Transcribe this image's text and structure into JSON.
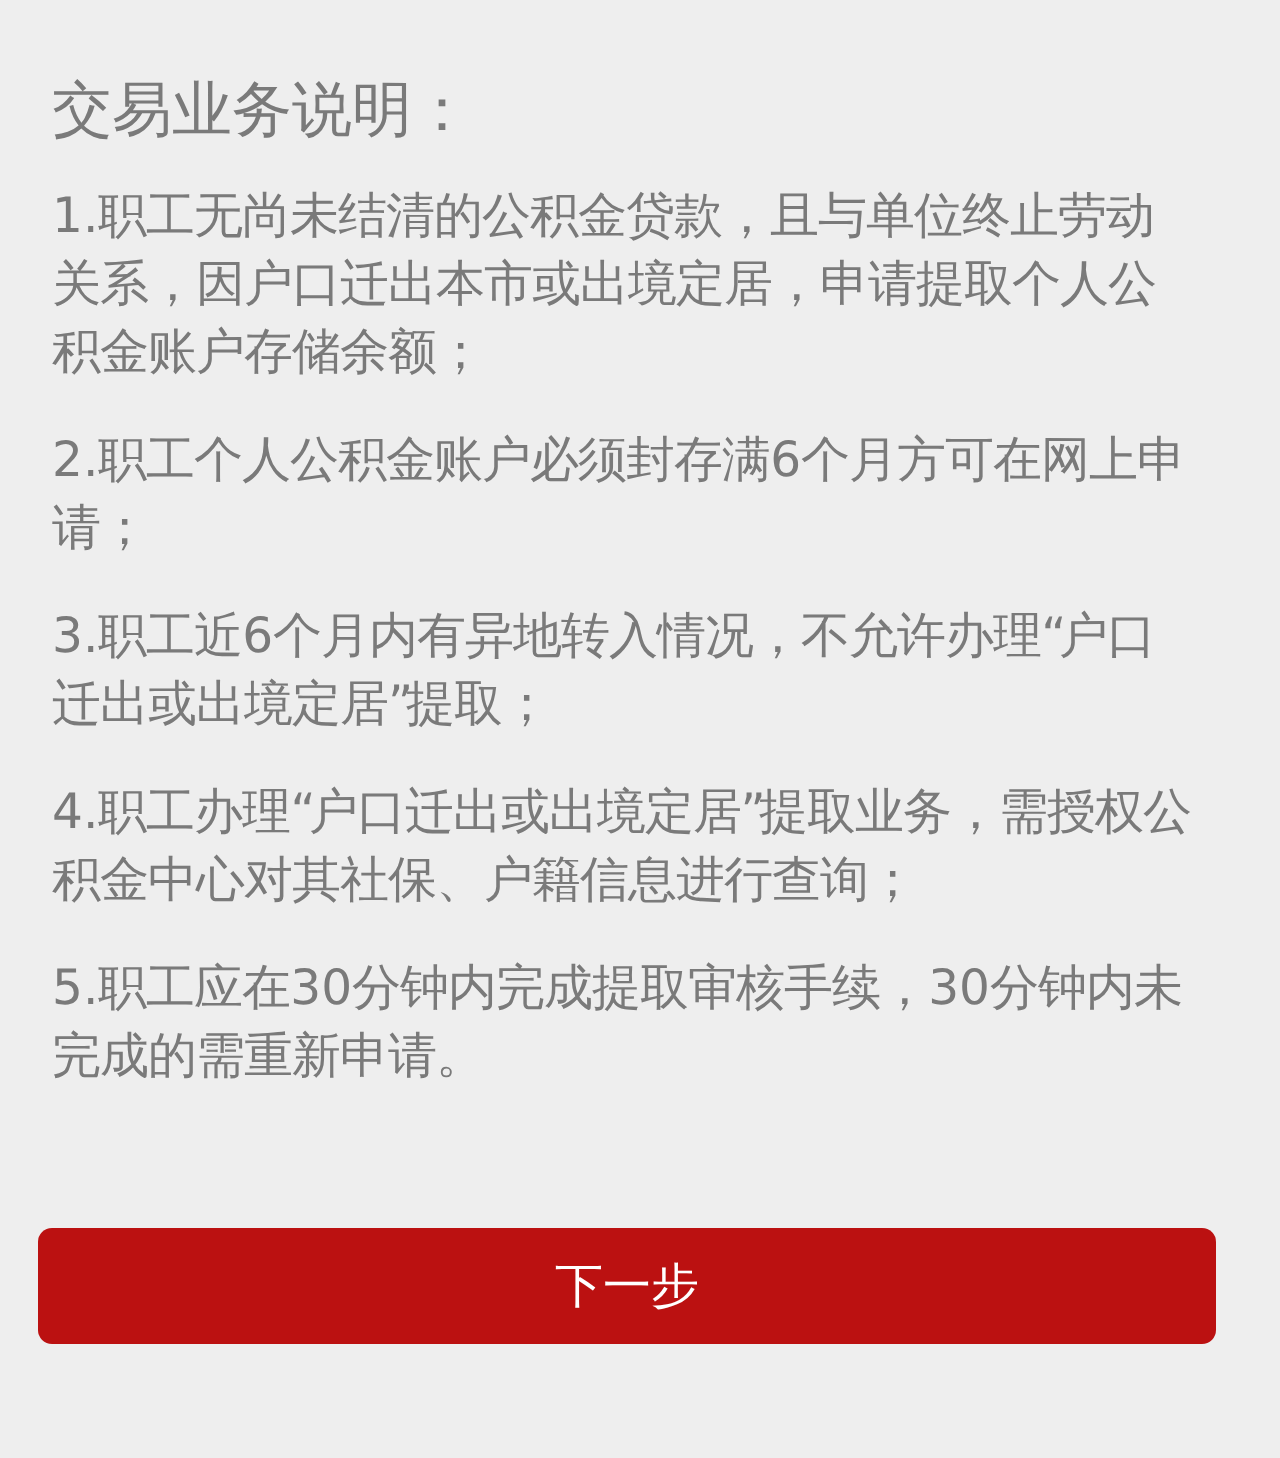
{
  "title": "交易业务说明：",
  "rules": [
    "1.职工无尚未结清的公积金贷款，且与单位终止劳动关系，因户口迁出本市或出境定居，申请提取个人公积金账户存储余额；",
    "2.职工个人公积金账户必须封存满6个月方可在网上申请；",
    "3.职工近6个月内有异地转入情况，不允许办理“户口迁出或出境定居”提取；",
    "4.职工办理“户口迁出或出境定居”提取业务，需授权公积金中心对其社保、户籍信息进行查询；",
    "5.职工应在30分钟内完成提取审核手续，30分钟内未完成的需重新申请。"
  ],
  "next_button": {
    "label": "下一步"
  }
}
